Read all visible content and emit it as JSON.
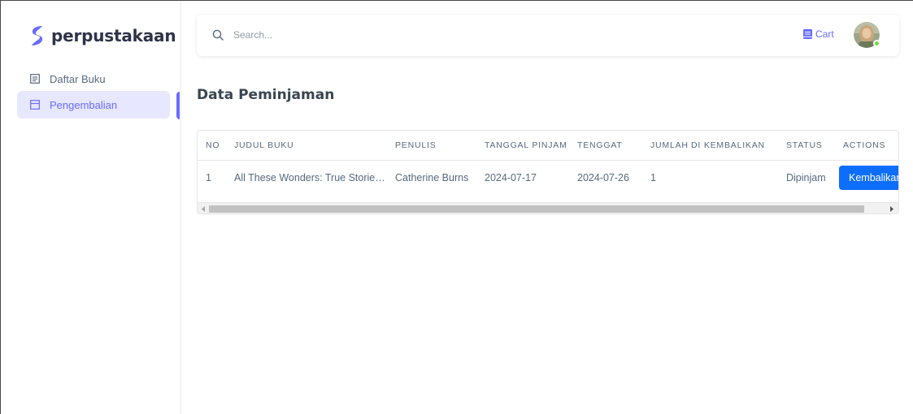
{
  "brand": {
    "name": "perpustakaan",
    "accent": "#696cff"
  },
  "sidebar": {
    "items": [
      {
        "label": "Daftar Buku",
        "icon": "book-list-icon",
        "active": false
      },
      {
        "label": "Pengembalian",
        "icon": "return-box-icon",
        "active": true
      }
    ]
  },
  "navbar": {
    "search": {
      "placeholder": "Search...",
      "value": "",
      "icon": "search-icon"
    },
    "cart": {
      "label": "Cart",
      "icon": "cart-icon"
    },
    "avatar": {
      "status_color": "#71dd37"
    }
  },
  "page": {
    "title": "Data Peminjaman"
  },
  "table": {
    "columns": [
      "No",
      "Judul Buku",
      "Penulis",
      "Tanggal Pinjam",
      "Tenggat",
      "Jumlah",
      "Di Kembalikan",
      "Status",
      "Actions"
    ],
    "rows": [
      {
        "no": "1",
        "judul": "All These Wonders: True Stories About Facing the Unknown",
        "penulis": "Catherine Burns",
        "tanggal_pinjam": "2024-07-17",
        "tenggat": "2024-07-26",
        "jumlah": "1",
        "dikembalikan": "",
        "status": "Dipinjam",
        "action_label": "Kembalikan"
      }
    ],
    "action_color": "#0d6efd"
  }
}
